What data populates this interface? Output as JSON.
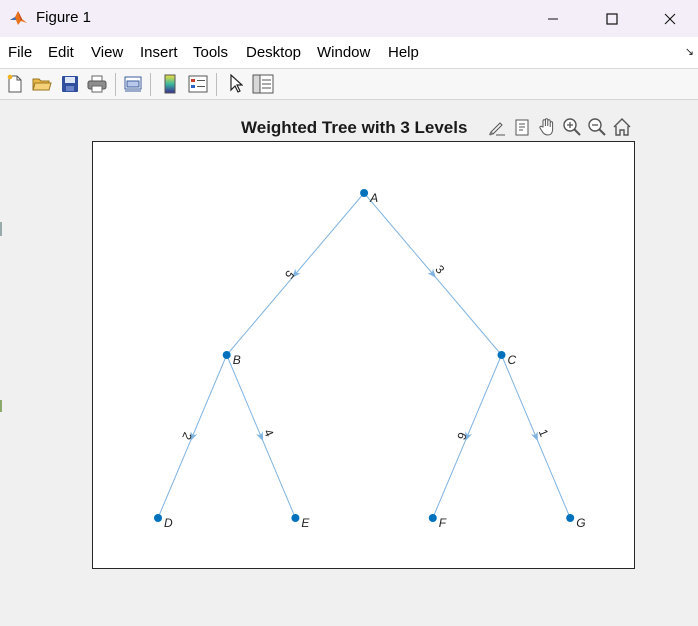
{
  "window": {
    "title": "Figure 1"
  },
  "menu": {
    "items": [
      "File",
      "Edit",
      "View",
      "Insert",
      "Tools",
      "Desktop",
      "Window",
      "Help"
    ],
    "dock_glyph": "↘"
  },
  "toolbar": {
    "buttons": [
      "new-figure-icon",
      "open-file-icon",
      "save-icon",
      "print-icon",
      "link-plot-icon",
      "colorbar-icon",
      "legend-icon",
      "edit-plot-icon",
      "property-inspector-icon"
    ]
  },
  "axes_toolbar": {
    "buttons": [
      "brush-icon",
      "data-tips-icon",
      "pan-hand-icon",
      "zoom-in-icon",
      "zoom-out-icon",
      "restore-view-icon"
    ]
  },
  "plot": {
    "title": "Weighted Tree with 3 Levels"
  },
  "colors": {
    "node": "#0072bd",
    "edge": "#7fb3e0",
    "axes_border": "#262626"
  },
  "graph": {
    "nodes": [
      {
        "id": "A",
        "level": 0,
        "order": 3
      },
      {
        "id": "B",
        "level": 1,
        "order": 1
      },
      {
        "id": "C",
        "level": 1,
        "order": 5
      },
      {
        "id": "D",
        "level": 2,
        "order": 0
      },
      {
        "id": "E",
        "level": 2,
        "order": 2
      },
      {
        "id": "F",
        "level": 2,
        "order": 4
      },
      {
        "id": "G",
        "level": 2,
        "order": 6
      }
    ],
    "edges": [
      {
        "from": "A",
        "to": "B",
        "weight": "5"
      },
      {
        "from": "A",
        "to": "C",
        "weight": "3"
      },
      {
        "from": "B",
        "to": "D",
        "weight": "2"
      },
      {
        "from": "B",
        "to": "E",
        "weight": "4"
      },
      {
        "from": "C",
        "to": "F",
        "weight": "6"
      },
      {
        "from": "C",
        "to": "G",
        "weight": "1"
      }
    ]
  }
}
